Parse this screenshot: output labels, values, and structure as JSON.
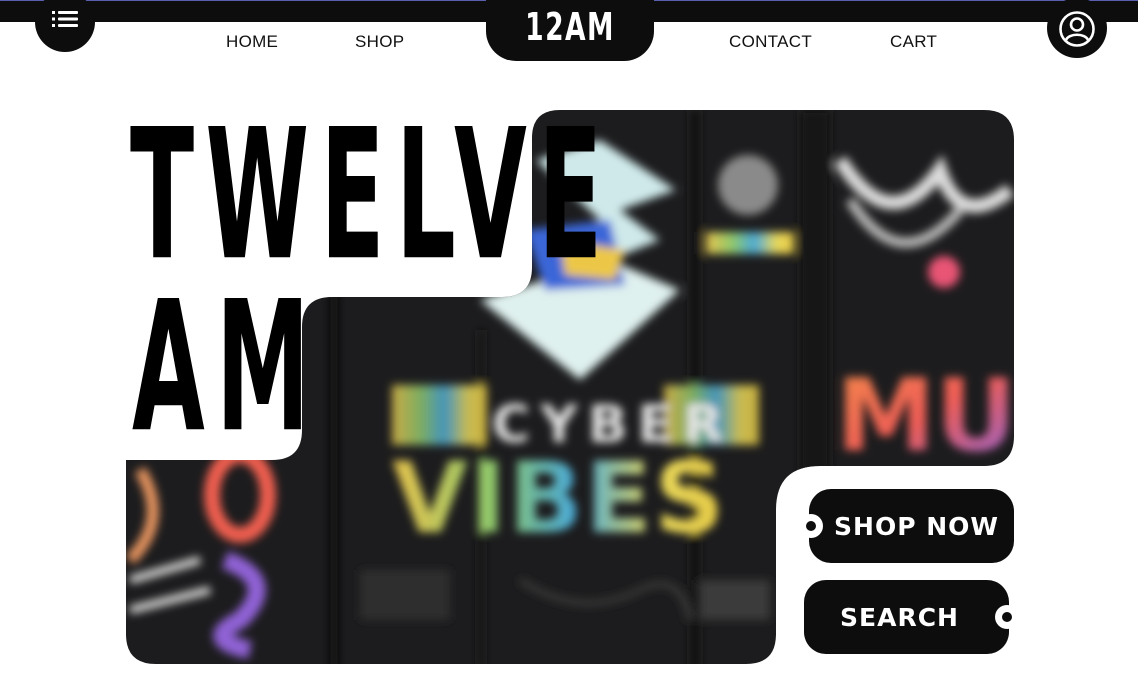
{
  "header": {
    "logo": "12AM",
    "nav": {
      "home": "HOME",
      "shop": "SHOP",
      "contact": "CONTACT",
      "cart": "CART"
    },
    "menu_icon": "hamburger-menu-icon",
    "account_icon": "user-account-icon"
  },
  "hero": {
    "title_line1": "TWELVE",
    "title_line2": "AM",
    "image_text": {
      "poster_1": "CYBER",
      "poster_2": "VIBES",
      "poster_3": "MU"
    },
    "shop_now_label": "SHOP NOW",
    "search_label": "SEARCH"
  },
  "colors": {
    "primary": "#0d0d0d",
    "background": "#ffffff",
    "accent_orange": "#f2604a",
    "accent_yellow": "#e7d64a",
    "accent_blue": "#4d6fe0",
    "accent_purple": "#8f6bd9"
  }
}
